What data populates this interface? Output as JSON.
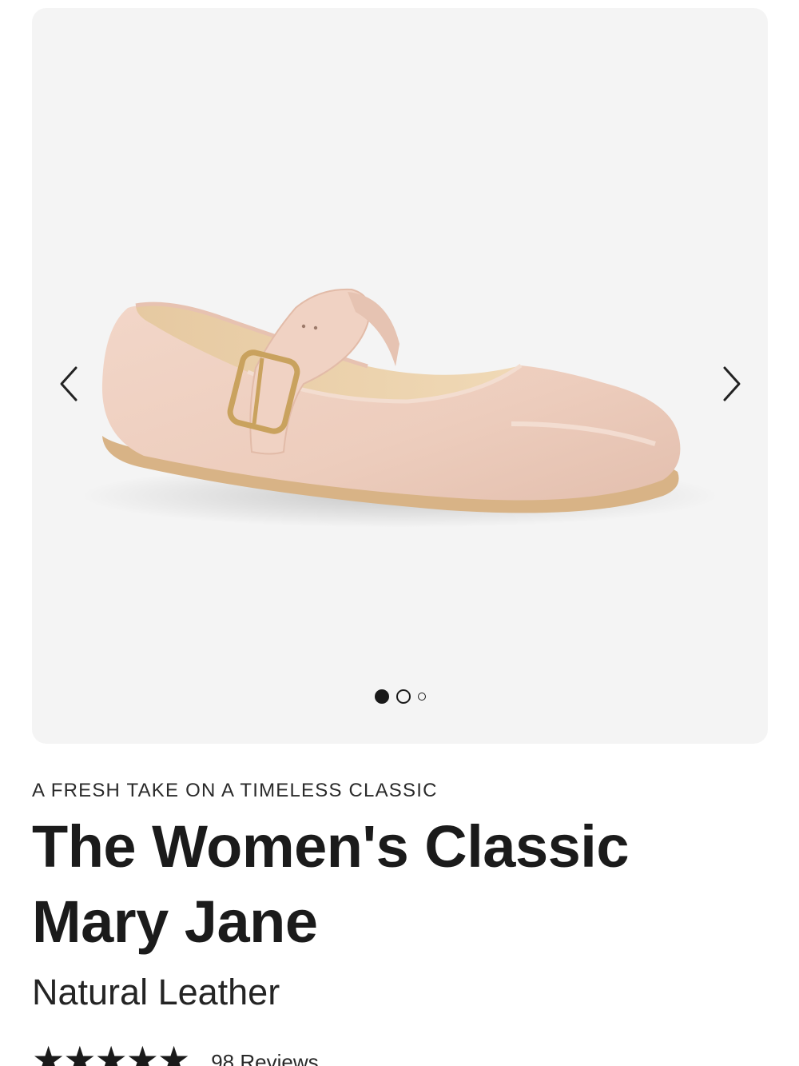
{
  "gallery": {
    "image_alt": "Pink leather Mary Jane flat with gold buckle strap",
    "slide_count": 3,
    "active_slide": 1
  },
  "product": {
    "eyebrow": "A FRESH TAKE ON A TIMELESS CLASSIC",
    "title": "The Women's Classic Mary Jane",
    "variant": "Natural Leather",
    "rating": 5,
    "stars": "★★★★★",
    "reviews_label": "98 Reviews"
  },
  "colors": {
    "gallery_bg": "#f4f4f4",
    "shoe_leather": "#efcfc0",
    "buckle": "#c9a25e",
    "text": "#1b1b1b"
  },
  "icons": {
    "prev": "chevron-left-icon",
    "next": "chevron-right-icon",
    "rating": "star-icon"
  }
}
